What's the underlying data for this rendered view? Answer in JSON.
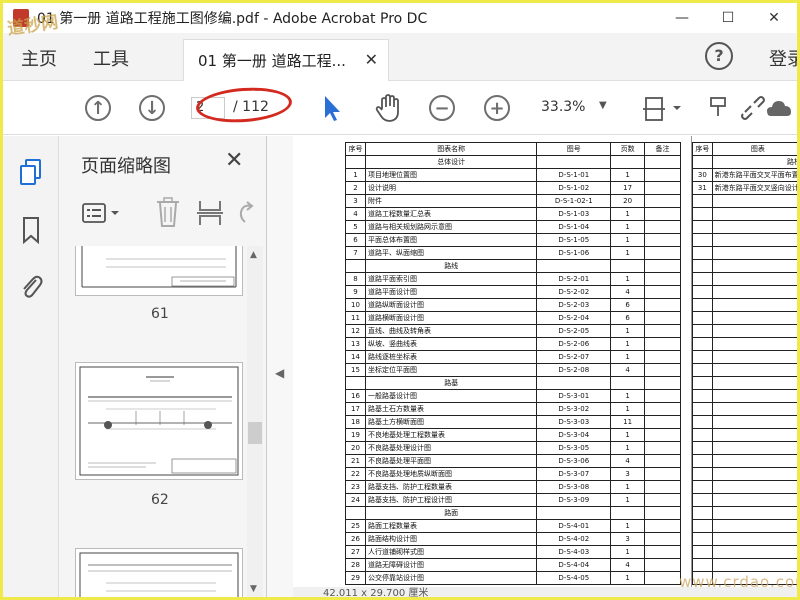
{
  "window": {
    "title": "01 第一册 道路工程施工图修编.pdf - Adobe Acrobat Pro DC",
    "minimize_glyph": "—",
    "maximize_glyph": "☐",
    "close_glyph": "✕"
  },
  "menubar": {
    "home": "主页",
    "tools": "工具",
    "doc_tab": "01 第一册 道路工程...",
    "doc_tab_close": "✕",
    "help_glyph": "?",
    "login": "登录"
  },
  "toolbar": {
    "page_current": "2",
    "page_total": "/ 112",
    "zoom": "33.3%",
    "zoom_caret": "▼",
    "prev_glyph": "↑",
    "next_glyph": "↓",
    "zoom_out_glyph": "−",
    "zoom_in_glyph": "+"
  },
  "thumb_panel": {
    "title": "页面缩略图",
    "close_glyph": "✕",
    "thumbs": [
      {
        "label": "61"
      },
      {
        "label": "62"
      }
    ]
  },
  "sheet": {
    "headers": {
      "no": "序号",
      "name": "图表名称",
      "code": "图号",
      "pages": "页数",
      "remark": "备注"
    },
    "sections": [
      {
        "title": "总体设计",
        "rows": [
          {
            "no": "1",
            "name": "项目地理位置图",
            "code": "D-S-1-01",
            "pages": "1"
          },
          {
            "no": "2",
            "name": "设计说明",
            "code": "D-S-1-02",
            "pages": "17"
          },
          {
            "no": "3",
            "name": "附件",
            "code": "D-S-1-02-1",
            "pages": "20"
          },
          {
            "no": "4",
            "name": "道路工程数量汇总表",
            "code": "D-S-1-03",
            "pages": "1"
          },
          {
            "no": "5",
            "name": "道路与相关规划路网示意图",
            "code": "D-S-1-04",
            "pages": "1"
          },
          {
            "no": "6",
            "name": "平面总体布置图",
            "code": "D-S-1-05",
            "pages": "1"
          },
          {
            "no": "7",
            "name": "道路平、纵面缩图",
            "code": "D-S-1-06",
            "pages": "1"
          }
        ]
      },
      {
        "title": "路线",
        "rows": [
          {
            "no": "8",
            "name": "道路平面索引图",
            "code": "D-S-2-01",
            "pages": "1"
          },
          {
            "no": "9",
            "name": "道路平面设计图",
            "code": "D-S-2-02",
            "pages": "4"
          },
          {
            "no": "10",
            "name": "道路纵断面设计图",
            "code": "D-S-2-03",
            "pages": "6"
          },
          {
            "no": "11",
            "name": "道路横断面设计图",
            "code": "D-S-2-04",
            "pages": "6"
          },
          {
            "no": "12",
            "name": "直线、曲线及转角表",
            "code": "D-S-2-05",
            "pages": "1"
          },
          {
            "no": "13",
            "name": "纵坡、竖曲线表",
            "code": "D-S-2-06",
            "pages": "1"
          },
          {
            "no": "14",
            "name": "路线逐桩坐标表",
            "code": "D-S-2-07",
            "pages": "1"
          },
          {
            "no": "15",
            "name": "坐标定位平面图",
            "code": "D-S-2-08",
            "pages": "4"
          }
        ]
      },
      {
        "title": "路基",
        "rows": [
          {
            "no": "16",
            "name": "一般路基设计图",
            "code": "D-S-3-01",
            "pages": "1"
          },
          {
            "no": "17",
            "name": "路基土石方数量表",
            "code": "D-S-3-02",
            "pages": "1"
          },
          {
            "no": "18",
            "name": "路基土方横断面图",
            "code": "D-S-3-03",
            "pages": "11"
          },
          {
            "no": "19",
            "name": "不良地基处理工程数量表",
            "code": "D-S-3-04",
            "pages": "1"
          },
          {
            "no": "20",
            "name": "不良路基处理设计图",
            "code": "D-S-3-05",
            "pages": "1"
          },
          {
            "no": "21",
            "name": "不良路基处理平面图",
            "code": "D-S-3-06",
            "pages": "4"
          },
          {
            "no": "22",
            "name": "不良路基处理地质纵断面图",
            "code": "D-S-3-07",
            "pages": "3"
          },
          {
            "no": "23",
            "name": "路基支挡、防护工程数量表",
            "code": "D-S-3-08",
            "pages": "1"
          },
          {
            "no": "24",
            "name": "路基支挡、防护工程设计图",
            "code": "D-S-3-09",
            "pages": "1"
          }
        ]
      },
      {
        "title": "路面",
        "rows": [
          {
            "no": "25",
            "name": "路面工程数量表",
            "code": "D-S-4-01",
            "pages": "1"
          },
          {
            "no": "26",
            "name": "路面结构设计图",
            "code": "D-S-4-02",
            "pages": "3"
          },
          {
            "no": "27",
            "name": "人行道铺砌样式图",
            "code": "D-S-4-03",
            "pages": "1"
          },
          {
            "no": "28",
            "name": "道路无障碍设计图",
            "code": "D-S-4-04",
            "pages": "4"
          },
          {
            "no": "29",
            "name": "公交停靠站设计图",
            "code": "D-S-4-05",
            "pages": "1"
          }
        ]
      }
    ],
    "right_headers": {
      "no": "序号",
      "name": "图表"
    },
    "right_section": "路桥",
    "right_rows": [
      {
        "no": "30",
        "name": "新港东路平面交叉平面布置"
      },
      {
        "no": "31",
        "name": "新港东路平面交叉竖向设计"
      }
    ]
  },
  "status": {
    "coords": "42.011 x 29.700 厘米"
  },
  "watermarks": {
    "top_left": "道秒网",
    "bottom_right": "www.crdao.com"
  }
}
